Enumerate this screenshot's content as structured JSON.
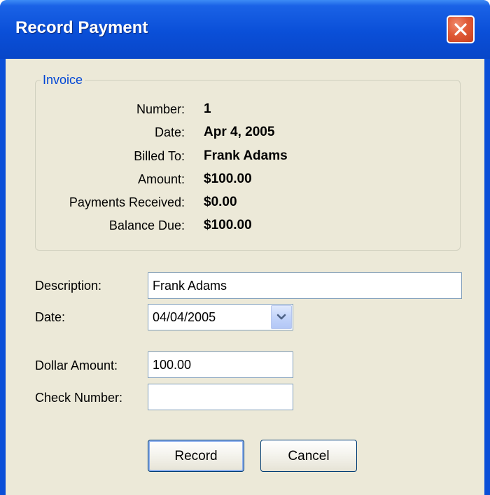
{
  "window": {
    "title": "Record Payment"
  },
  "invoice": {
    "legend": "Invoice",
    "rows": [
      {
        "label": "Number:",
        "value": "1"
      },
      {
        "label": "Date:",
        "value": "Apr 4, 2005"
      },
      {
        "label": "Billed To:",
        "value": "Frank Adams"
      },
      {
        "label": "Amount:",
        "value": "$100.00"
      },
      {
        "label": "Payments Received:",
        "value": "$0.00"
      },
      {
        "label": "Balance Due:",
        "value": "$100.00"
      }
    ]
  },
  "form": {
    "description_label": "Description:",
    "description_value": "Frank Adams",
    "date_label": "Date:",
    "date_value": "04/04/2005",
    "dollar_label": "Dollar Amount:",
    "dollar_value": "100.00",
    "check_label": "Check Number:",
    "check_value": ""
  },
  "buttons": {
    "record_label": "Record",
    "cancel_label": "Cancel"
  },
  "icons": {
    "close": "close-icon",
    "dropdown": "chevron-down-icon"
  },
  "colors": {
    "titlebar": "#0a4fd8",
    "dialog_background": "#ece9d8",
    "legend_text": "#0046d5",
    "close_button": "#e05a37"
  }
}
